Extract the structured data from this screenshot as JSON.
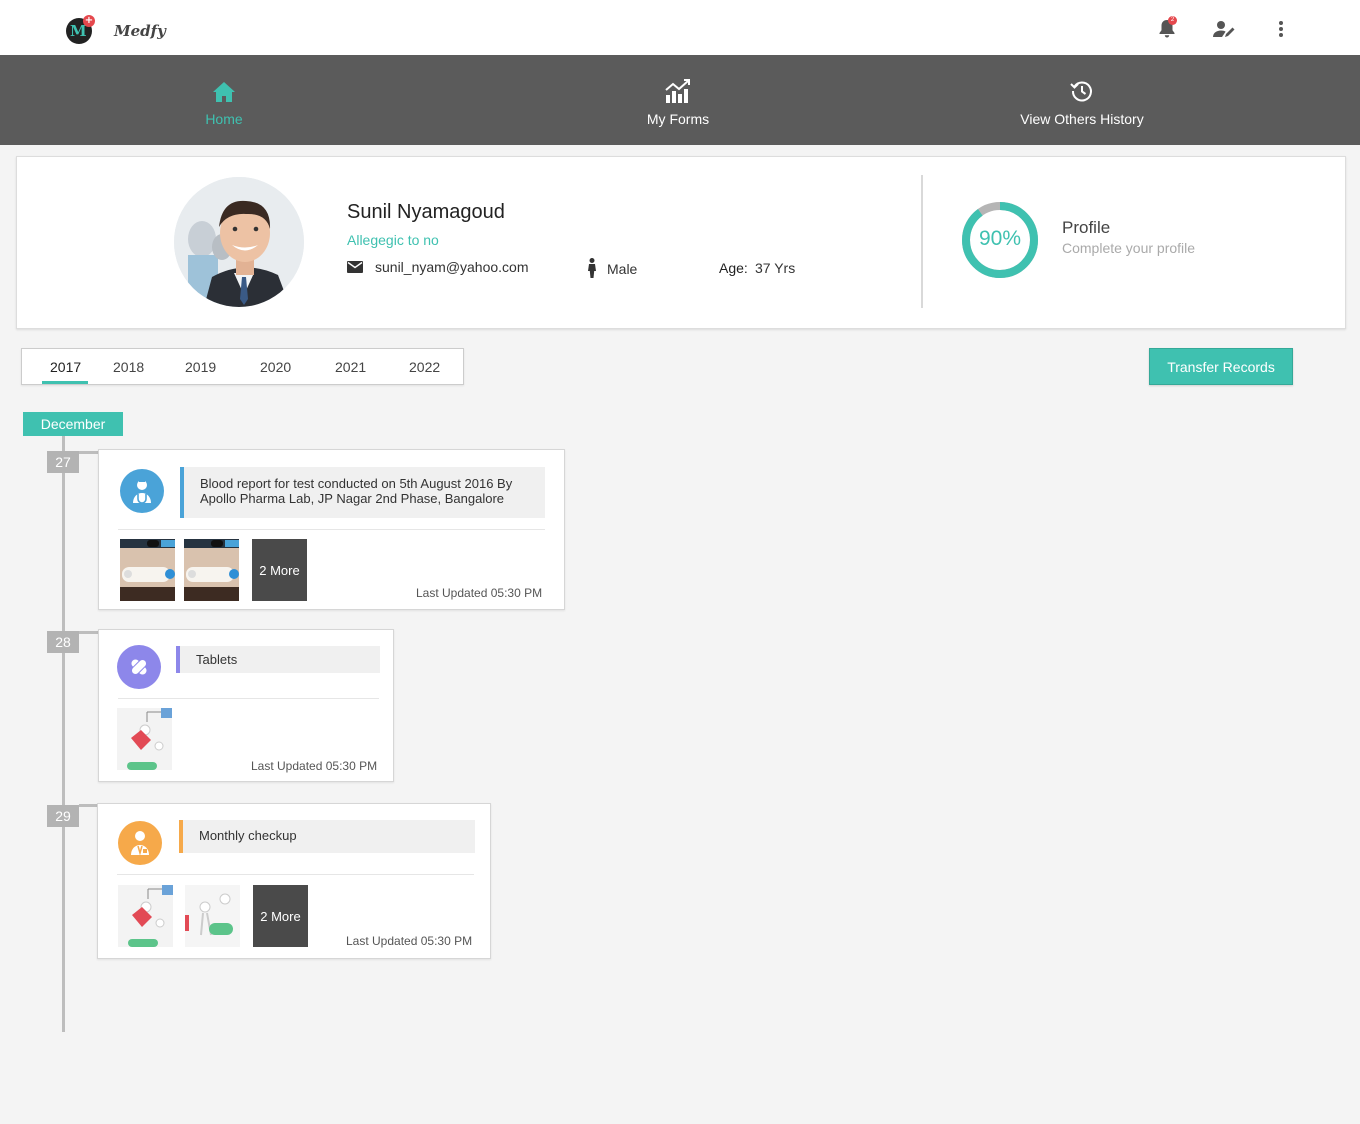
{
  "header": {
    "brand": "Medfy",
    "logo_letter": "M",
    "notification_count": "2",
    "icons": [
      "bell-icon",
      "user-edit-icon",
      "more-vert-icon"
    ]
  },
  "nav": {
    "items": [
      {
        "label": "Home",
        "icon": "home-icon",
        "active": true
      },
      {
        "label": "My Forms",
        "icon": "chart-icon",
        "active": false
      },
      {
        "label": "View Others History",
        "icon": "history-icon",
        "active": false
      }
    ]
  },
  "profile": {
    "name": "Sunil Nyamagoud",
    "allergic": "Allegegic to no",
    "email": "sunil_nyam@yahoo.com",
    "gender": "Male",
    "age_label": "Age:",
    "age": "37 Yrs",
    "completion_percent": 90,
    "completion_text": "90%",
    "profile_title": "Profile",
    "profile_subtitle": "Complete your profile"
  },
  "years": {
    "items": [
      "2017",
      "2018",
      "2019",
      "2020",
      "2021",
      "2022"
    ],
    "selected": "2017"
  },
  "actions": {
    "transfer_label": "Transfer Records"
  },
  "timeline": {
    "month": "December",
    "entries": [
      {
        "day": "27",
        "description_line1": "Blood report for test conducted on 5th August 2016 By",
        "description_line2": "Apollo Pharma Lab, JP Nagar 2nd Phase, Bangalore",
        "category_icon": "doctor-icon",
        "accent": "#4aa3d8",
        "more_label": "2 More",
        "updated": "Last Updated 05:30 PM"
      },
      {
        "day": "28",
        "description_line1": "Tablets",
        "category_icon": "pills-icon",
        "accent": "#8d87ea",
        "updated": "Last Updated 05:30 PM"
      },
      {
        "day": "29",
        "description_line1": "Monthly checkup",
        "category_icon": "checkup-icon",
        "accent": "#f6a94a",
        "more_label": "2 More",
        "updated": "Last Updated 05:30 PM"
      }
    ]
  },
  "colors": {
    "accent": "#3fc1b0",
    "navbar": "#5b5b5b",
    "background": "#f4f4f4",
    "notification": "#e5484d"
  }
}
